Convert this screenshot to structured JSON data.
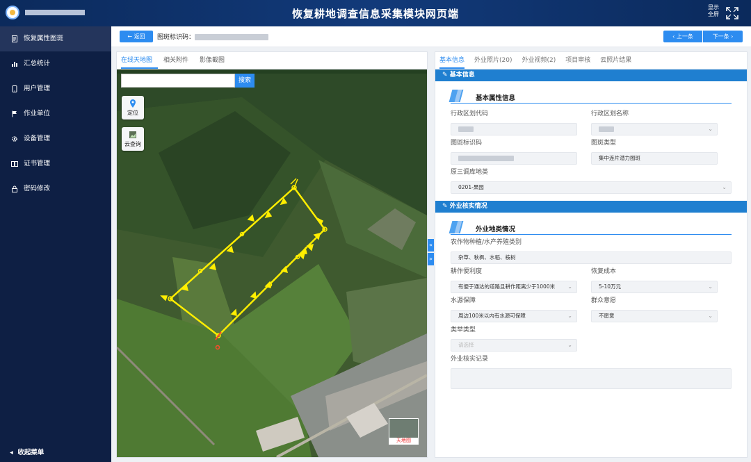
{
  "header": {
    "title": "恢复耕地调查信息采集模块网页端",
    "fullscreen_label_1": "显示",
    "fullscreen_label_2": "全屏"
  },
  "sidebar": {
    "items": [
      {
        "label": "恢复属性图斑",
        "icon": "doc-icon",
        "active": true
      },
      {
        "label": "汇总统计",
        "icon": "bar-chart-icon",
        "active": false
      },
      {
        "label": "用户管理",
        "icon": "phone-icon",
        "active": false
      },
      {
        "label": "作业单位",
        "icon": "flag-icon",
        "active": false
      },
      {
        "label": "设备管理",
        "icon": "gear-icon",
        "active": false
      },
      {
        "label": "证书管理",
        "icon": "book-icon",
        "active": false
      },
      {
        "label": "密码修改",
        "icon": "lock-icon",
        "active": false
      }
    ],
    "collapse_label": "收起菜单"
  },
  "toolbar": {
    "back_label": "返回",
    "tuban_label": "图斑标识码：",
    "prev_label": "上一条",
    "next_label": "下一条"
  },
  "left_tabs": [
    "在线天地图",
    "相关附件",
    "影像截图"
  ],
  "map": {
    "search_placeholder": "",
    "search_button": "搜索",
    "locate_label": "定位",
    "cloud_label": "云查询",
    "basemap_label": "天地图"
  },
  "right_tabs": [
    "基本信息",
    "外业照片(20)",
    "外业视频(2)",
    "项目审核",
    "云照片结果"
  ],
  "basic_info": {
    "section_title": "基本信息",
    "subsection_title": "基本属性信息",
    "fields": {
      "region_code_label": "行政区划代码",
      "region_name_label": "行政区划名称",
      "tuban_id_label": "图斑标识码",
      "tuban_type_label": "图斑类型",
      "tuban_type_value": "集中连片潜力图斑",
      "land_class_label": "原三调库地类",
      "land_class_value": "0201-果园"
    }
  },
  "field_check": {
    "section_title": "外业核实情况",
    "subsection_title": "外业地类情况",
    "crop_label": "农作物种植/水产养殖类别",
    "crop_value": "杂草、秋枫、水稻、桉树",
    "convenience_label": "耕作便利度",
    "convenience_value": "有便于通达的道路且耕作距离少于1000米",
    "cost_label": "恢复成本",
    "cost_value": "5-10万元",
    "water_label": "水源保障",
    "water_value": "周边100米以内有水源可保障",
    "willingness_label": "群众意愿",
    "willingness_value": "不愿意",
    "reclaim_label": "类举类型",
    "reclaim_placeholder": "请选择",
    "record_label": "外业核实记录"
  },
  "colors": {
    "accent": "#2d8cf0",
    "sidebar_bg": "#0e1f44",
    "section_bar": "#1f7fd0",
    "polygon": "#ffee00"
  }
}
